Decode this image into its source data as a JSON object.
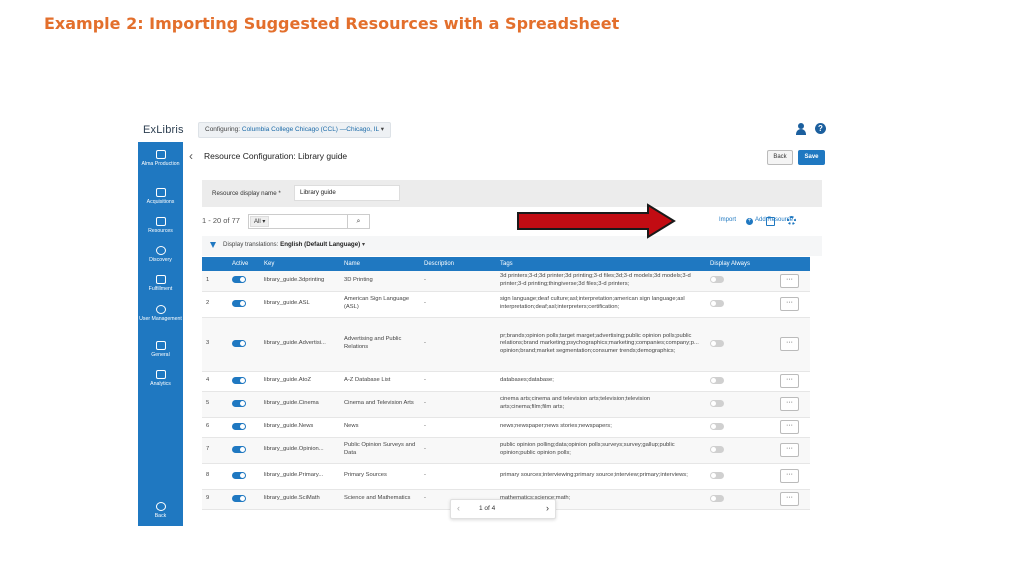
{
  "slide": {
    "title": "Example 2: Importing Suggested Resources with a Spreadsheet"
  },
  "colors": {
    "brand": "#1f78c1",
    "title_orange": "#e36f2c",
    "arrow_red": "#c20c13"
  },
  "topbar": {
    "logo": "ExLibris",
    "configuring_label": "Configuring:",
    "institution": "Columbia College Chicago (CCL) —Chicago, IL",
    "user_icon": "user-icon",
    "help_icon": "help-icon",
    "help_glyph": "?"
  },
  "sidebar": {
    "items": [
      {
        "label": "Alma Production",
        "icon": "alma-icon"
      },
      {
        "label": "Acquisitions",
        "icon": "acquisitions-icon"
      },
      {
        "label": "Resources",
        "icon": "resources-icon"
      },
      {
        "label": "Discovery",
        "icon": "discovery-icon"
      },
      {
        "label": "Fulfillment",
        "icon": "fulfillment-icon"
      },
      {
        "label": "User Management",
        "icon": "user-management-icon"
      },
      {
        "label": "General",
        "icon": "general-icon"
      },
      {
        "label": "Analytics",
        "icon": "analytics-icon"
      }
    ],
    "back_label": "Back"
  },
  "header": {
    "title": "Resource Configuration: Library guide",
    "back_button": "Back",
    "save_button": "Save"
  },
  "form": {
    "label": "Resource display name *",
    "value": "Library guide"
  },
  "toolbar": {
    "range": "1 - 20 of 77",
    "filter_value": "All",
    "import_label": "Import",
    "add_resource_label": "Add Resource"
  },
  "translations": {
    "label": "Display translations:",
    "value": "English (Default Language)"
  },
  "table": {
    "headers": [
      "",
      "Active",
      "Key",
      "Name",
      "Description",
      "Tags",
      "Display Always",
      ""
    ],
    "rows": [
      {
        "num": "1",
        "active": true,
        "key": "library_guide.3dprinting",
        "name": "3D Printing",
        "description": "-",
        "tags": "3d printers;3-d;3d printer;3d printing;3-d files;3d;3-d models;3d models;3-d printer;3-d printing;thingiverse;3d files;3-d printers;",
        "display_always": false
      },
      {
        "num": "2",
        "active": true,
        "key": "library_guide.ASL",
        "name": "American Sign Language (ASL)",
        "description": "-",
        "tags": "sign language;deaf culture;asl;interpretation;american sign language;asl interpretation;deaf;asl;interpreters;certification;",
        "display_always": false
      },
      {
        "num": "3",
        "active": true,
        "key": "library_guide.Advertisi...",
        "name": "Advertising and Public Relations",
        "description": "-",
        "tags": "pr;brands;opinion polls;target marget;advertising;public opinion polls;public relations;brand marketing;psychographics;marketing;companies;company;p... opinion;brand;market segmentation;consumer trends;demographics;",
        "display_always": false
      },
      {
        "num": "4",
        "active": true,
        "key": "library_guide.AtoZ",
        "name": "A-Z Database List",
        "description": "-",
        "tags": "databases;database;",
        "display_always": false
      },
      {
        "num": "5",
        "active": true,
        "key": "library_guide.Cinema",
        "name": "Cinema and Television Arts",
        "description": "-",
        "tags": "cinema arts;cinema and television arts;television;television arts;cinema;film;film arts;",
        "display_always": false
      },
      {
        "num": "6",
        "active": true,
        "key": "library_guide.News",
        "name": "News",
        "description": "-",
        "tags": "news;newspaper;news stories;newspapers;",
        "display_always": false
      },
      {
        "num": "7",
        "active": true,
        "key": "library_guide.Opinion...",
        "name": "Public Opinion Surveys and Data",
        "description": "-",
        "tags": "public opinion polling;data;opinion polls;surveys;survey;gallup;public opinion;public opinion polls;",
        "display_always": false
      },
      {
        "num": "8",
        "active": true,
        "key": "library_guide.Primary...",
        "name": "Primary Sources",
        "description": "-",
        "tags": "primary sources;interviewing;primary source;interview;primary;interviews;",
        "display_always": false
      },
      {
        "num": "9",
        "active": true,
        "key": "library_guide.SciMath",
        "name": "Science and Mathematics",
        "description": "-",
        "tags": "mathematics;science;math;",
        "display_always": false
      }
    ],
    "row_action": "···"
  },
  "pager": {
    "label": "1 of 4",
    "prev": "‹",
    "next": "›"
  }
}
